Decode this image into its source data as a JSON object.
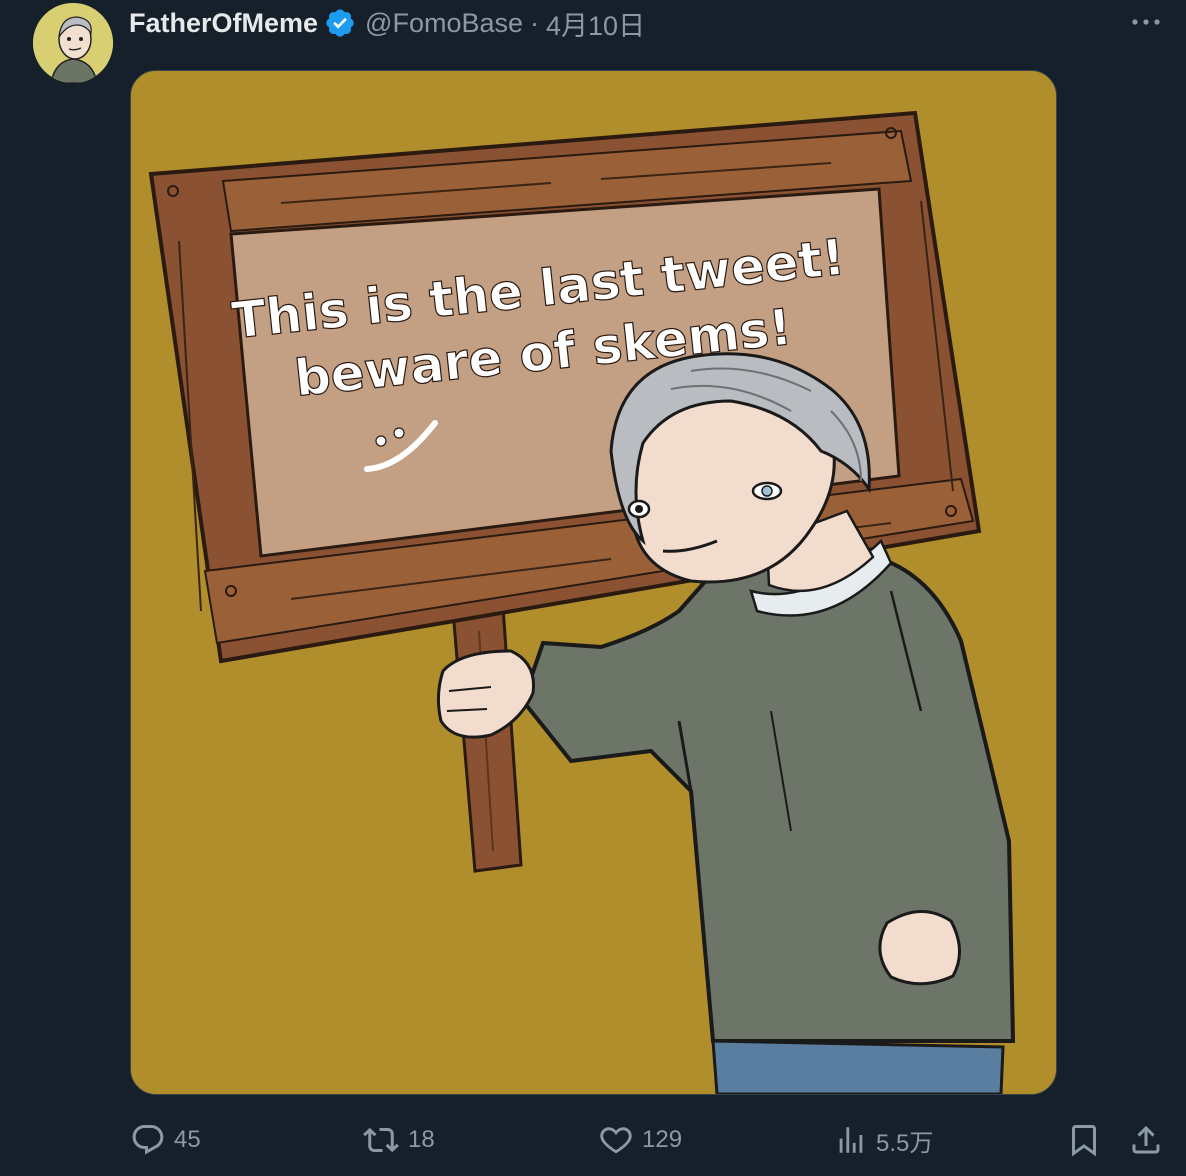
{
  "author": {
    "display_name": "FatherOfMeme",
    "handle": "@FomoBase",
    "separator": "·",
    "date": "4月10日",
    "verified": true,
    "avatar_icon": "cartoon-old-man-avatar"
  },
  "media": {
    "sign_text_line1": "This is the last tweet!",
    "sign_text_line2": "beware of skems!",
    "sign_doodle": ":-/",
    "background_color": "#b18e2c"
  },
  "actions": {
    "replies": "45",
    "reposts": "18",
    "likes": "129",
    "views": "5.5万"
  },
  "colors": {
    "background": "#15202b",
    "text_primary": "#e7e9ea",
    "text_secondary": "#8b98a5",
    "verified_blue": "#1d9bf0"
  }
}
